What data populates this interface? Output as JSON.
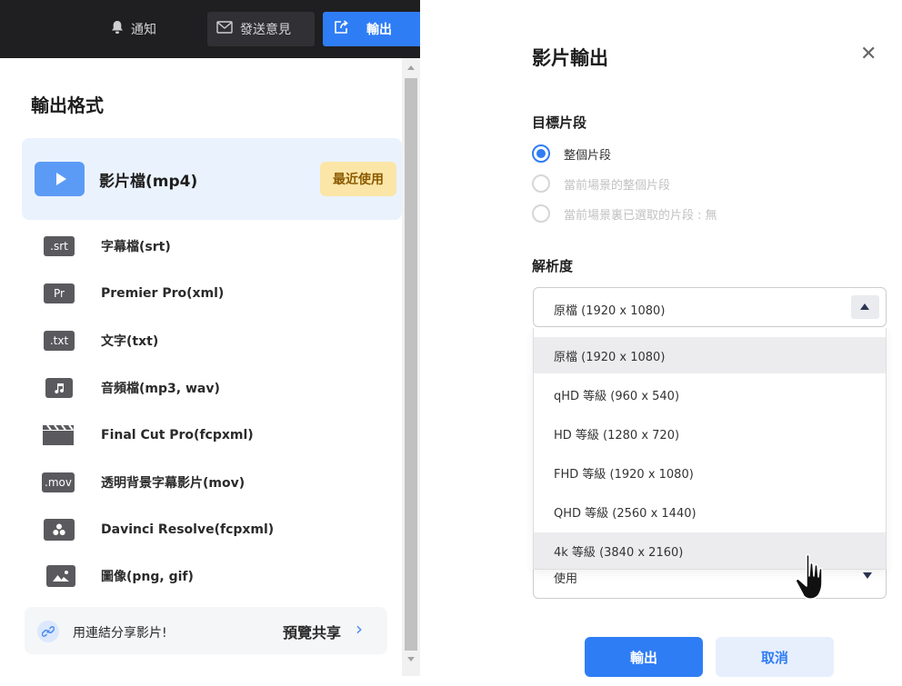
{
  "topbar": {
    "notify_label": "通知",
    "feedback_label": "發送意見",
    "export_label": "輸出"
  },
  "format_panel": {
    "title": "輸出格式",
    "mp4": {
      "label": "影片檔(mp4)",
      "badge": "最近使用"
    },
    "items": [
      {
        "badge": ".srt",
        "label": "字幕檔(srt)",
        "icon": "srt-icon"
      },
      {
        "badge": "Pr",
        "label": "Premier Pro(xml)",
        "icon": "premiere-icon"
      },
      {
        "badge": ".txt",
        "label": "文字(txt)",
        "icon": "txt-icon"
      },
      {
        "badge": "",
        "label": "音頻檔(mp3, wav)",
        "icon": "music-note-icon"
      },
      {
        "badge": "",
        "label": "Final Cut Pro(fcpxml)",
        "icon": "clapperboard-icon"
      },
      {
        "badge": ".mov",
        "label": "透明背景字幕影片(mov)",
        "icon": "mov-icon"
      },
      {
        "badge": "",
        "label": "Davinci Resolve(fcpxml)",
        "icon": "davinci-icon"
      },
      {
        "badge": "",
        "label": "圖像(png, gif)",
        "icon": "image-icon"
      }
    ],
    "share": {
      "text": "用連結分享影片!",
      "link": "預覽共享"
    }
  },
  "dialog": {
    "title": "影片輸出",
    "segment_title": "目標片段",
    "segment_options": [
      {
        "label": "整個片段",
        "selected": true,
        "enabled": true
      },
      {
        "label": "當前場景的整個片段",
        "selected": false,
        "enabled": false
      },
      {
        "label": "當前場景裏已選取的片段 : 無",
        "selected": false,
        "enabled": false
      }
    ],
    "resolution_title": "解析度",
    "resolution_value": "原檔 (1920 x 1080)",
    "resolution_options": [
      "原檔 (1920 x 1080)",
      "qHD 等級 (960 x 540)",
      "HD 等級 (1280 x 720)",
      "FHD 等級 (1920 x 1080)",
      "QHD 等級 (2560 x 1440)",
      "4k 等級 (3840 x 2160)"
    ],
    "hidden_select_value": "使用",
    "export_button": "輸出",
    "cancel_button": "取消"
  },
  "colors": {
    "accent": "#2f7df5",
    "topbar_bg": "#1f1f21",
    "recent_badge_bg": "#fbe6a8",
    "mp4_row_bg": "#eaf2fe"
  }
}
